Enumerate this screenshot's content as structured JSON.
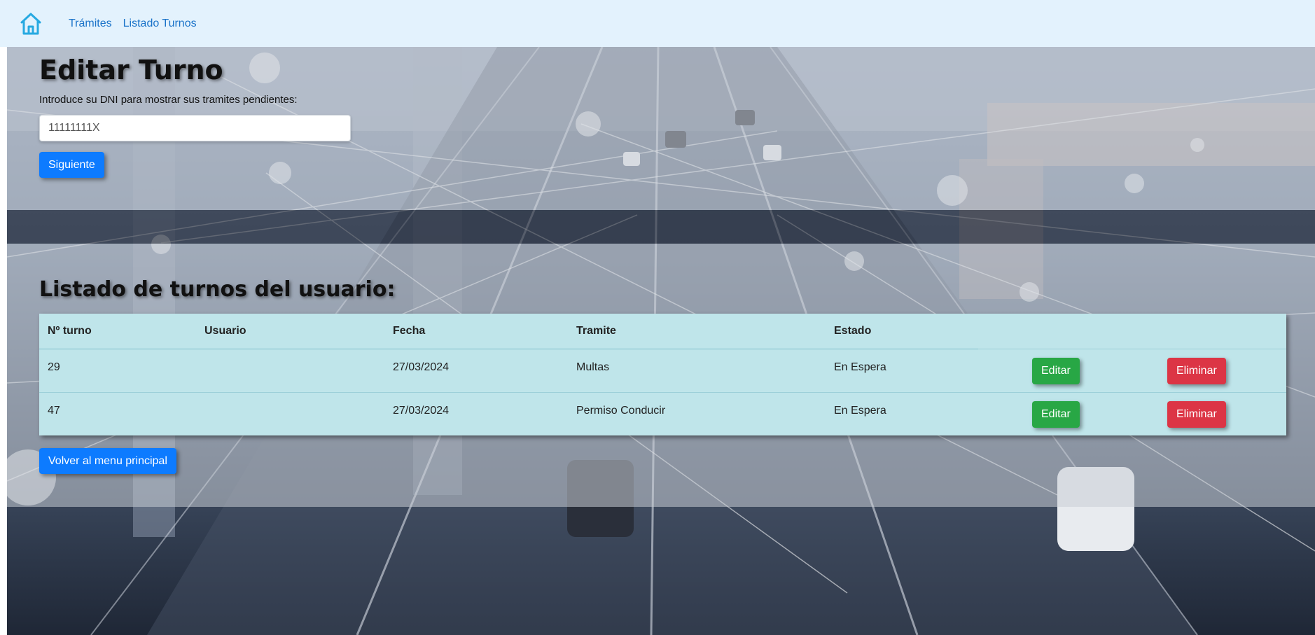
{
  "navbar": {
    "home_icon": "home-icon",
    "links": [
      "Trámites",
      "Listado Turnos"
    ]
  },
  "edit_section": {
    "title": "Editar Turno",
    "instruction": "Introduce su DNI para mostrar sus tramites pendientes:",
    "dni_value": "11111111X",
    "next_button": "Siguiente"
  },
  "list_section": {
    "title": "Listado de turnos del usuario:",
    "columns": [
      "Nº turno",
      "Usuario",
      "Fecha",
      "Tramite",
      "Estado"
    ],
    "rows": [
      {
        "turno": "29",
        "usuario": "",
        "fecha": "27/03/2024",
        "tramite": "Multas",
        "estado": "En Espera",
        "edit": "Editar",
        "delete": "Eliminar"
      },
      {
        "turno": "47",
        "usuario": "",
        "fecha": "27/03/2024",
        "tramite": "Permiso Conducir",
        "estado": "En Espera",
        "edit": "Editar",
        "delete": "Eliminar"
      }
    ],
    "back_button": "Volver al menu principal"
  },
  "colors": {
    "primary": "#0d7bff",
    "success": "#28a745",
    "danger": "#dc3545",
    "table_bg": "#bfe5ea",
    "navbar_bg": "#e3f2fd"
  }
}
